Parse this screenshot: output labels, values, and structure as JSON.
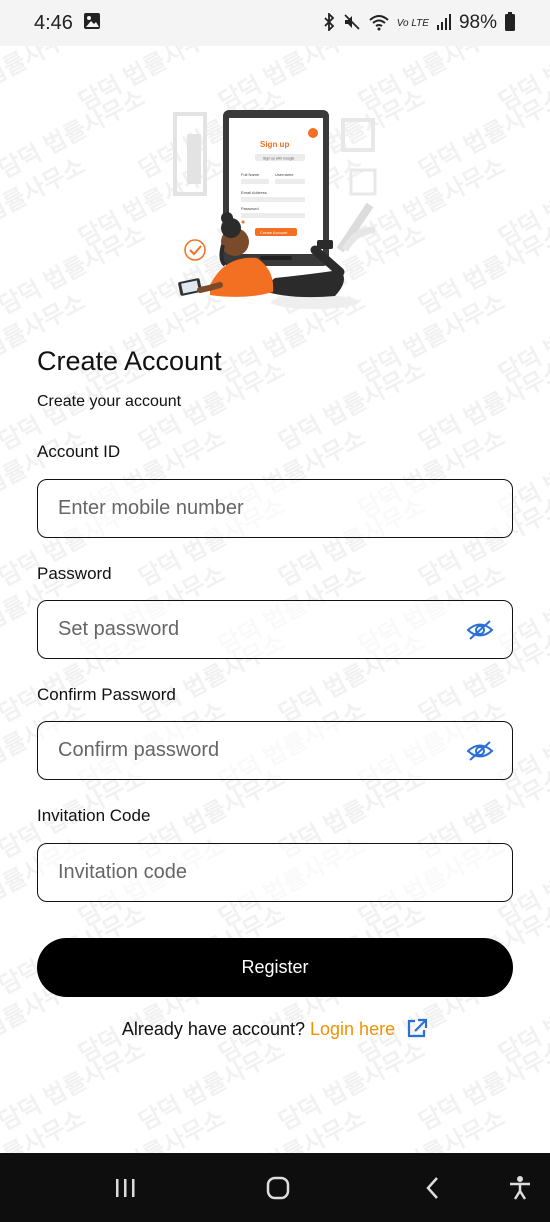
{
  "status_bar": {
    "time": "4:46",
    "battery_percent": "98%",
    "network_label": "Vo LTE"
  },
  "hero": {
    "card_title": "Sign up",
    "card_google": "Sign up with Google",
    "card_full_name": "Full Name",
    "card_username": "Username",
    "card_email": "Email Address",
    "card_password": "Password",
    "card_button": "Create Account"
  },
  "watermark_text": "담덕 법률사무소",
  "header": {
    "title": "Create Account",
    "subtitle": "Create your account"
  },
  "form": {
    "account_id": {
      "label": "Account ID",
      "placeholder": "Enter mobile number"
    },
    "password": {
      "label": "Password",
      "placeholder": "Set password"
    },
    "confirm_password": {
      "label": "Confirm Password",
      "placeholder": "Confirm password"
    },
    "invitation_code": {
      "label": "Invitation Code",
      "placeholder": "Invitation code"
    }
  },
  "register_label": "Register",
  "login_prompt": "Already have account?",
  "login_link": "Login here",
  "colors": {
    "accent": "#f39200",
    "primary_button": "#000000",
    "eye_icon": "#2a6fd6"
  },
  "icons": [
    "gallery-icon",
    "bluetooth-icon",
    "mute-icon",
    "wifi-icon",
    "signal-icon",
    "battery-icon",
    "eye-off-icon",
    "external-link-icon",
    "recents-icon",
    "home-icon",
    "back-icon",
    "accessibility-icon"
  ]
}
